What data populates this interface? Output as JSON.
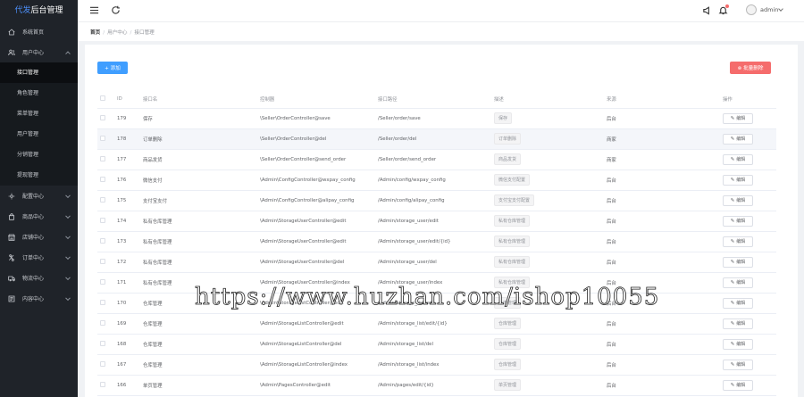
{
  "app": {
    "logo_prefix": "代发",
    "logo_suffix": "后台管理"
  },
  "sidebar": {
    "items": [
      {
        "label": "系统首页",
        "icon": "home-icon"
      },
      {
        "label": "用户中心",
        "icon": "users-icon",
        "open": true
      },
      {
        "label": "配置中心",
        "icon": "config-icon"
      },
      {
        "label": "商品中心",
        "icon": "shop-icon"
      },
      {
        "label": "店铺中心",
        "icon": "store-icon"
      },
      {
        "label": "订单中心",
        "icon": "order-icon"
      },
      {
        "label": "物流中心",
        "icon": "logistics-icon"
      },
      {
        "label": "内容中心",
        "icon": "content-icon"
      }
    ],
    "submenu": [
      "接口管理",
      "角色管理",
      "菜单管理",
      "用户管理",
      "分销管理",
      "提现管理"
    ],
    "active_sub": "接口管理"
  },
  "topbar": {
    "username": "admin"
  },
  "breadcrumb": {
    "home": "首页",
    "parent": "用户中心",
    "current": "接口管理"
  },
  "toolbar": {
    "add_label": "+ 添加",
    "batch_delete_label": "⊗ 批量删除"
  },
  "table": {
    "headers": {
      "id": "ID",
      "name": "接口名",
      "controller": "控制器",
      "path": "接口路径",
      "desc": "描述",
      "source": "来源",
      "ops": "操作"
    },
    "edit_label": "编辑",
    "rows": [
      {
        "id": "179",
        "name": "保存",
        "controller": "\\Seller\\OrderController@save",
        "path": "/Seller/order/save",
        "desc": "保存",
        "source": "后台"
      },
      {
        "id": "178",
        "name": "订单删除",
        "controller": "\\Seller\\OrderController@del",
        "path": "/Seller/order/del",
        "desc": "订单删除",
        "source": "商家"
      },
      {
        "id": "177",
        "name": "商品发货",
        "controller": "\\Seller\\OrderController@send_order",
        "path": "/Seller/order/send_order",
        "desc": "商品发货",
        "source": "商家"
      },
      {
        "id": "176",
        "name": "微信支付",
        "controller": "\\Admin\\ConfigController@wxpay_config",
        "path": "/Admin/config/wxpay_config",
        "desc": "微信支付配置",
        "source": "后台"
      },
      {
        "id": "175",
        "name": "支付宝支付",
        "controller": "\\Admin\\ConfigController@alipay_config",
        "path": "/Admin/config/alipay_config",
        "desc": "支付宝支付配置",
        "source": "后台"
      },
      {
        "id": "174",
        "name": "私有仓库管理",
        "controller": "\\Admin\\StorageUserController@edit",
        "path": "/Admin/storage_user/edit",
        "desc": "私有仓库管理",
        "source": "后台"
      },
      {
        "id": "173",
        "name": "私有仓库管理",
        "controller": "\\Admin\\StorageUserController@edit",
        "path": "/Admin/storage_user/edit/{id}",
        "desc": "私有仓库管理",
        "source": "后台"
      },
      {
        "id": "172",
        "name": "私有仓库管理",
        "controller": "\\Admin\\StorageUserController@del",
        "path": "/Admin/storage_user/del",
        "desc": "私有仓库管理",
        "source": "后台"
      },
      {
        "id": "171",
        "name": "私有仓库管理",
        "controller": "\\Admin\\StorageUserController@index",
        "path": "/Admin/storage_user/index",
        "desc": "私有仓库管理",
        "source": "后台"
      },
      {
        "id": "170",
        "name": "仓库管理",
        "controller": "\\Admin\\StorageListController@edit",
        "path": "/Admin/storage_list/edit",
        "desc": "仓库管理",
        "source": "后台"
      },
      {
        "id": "169",
        "name": "仓库管理",
        "controller": "\\Admin\\StorageListController@edit",
        "path": "/Admin/storage_list/edit/{id}",
        "desc": "仓库管理",
        "source": "后台"
      },
      {
        "id": "168",
        "name": "仓库管理",
        "controller": "\\Admin\\StorageListController@del",
        "path": "/Admin/storage_list/del",
        "desc": "仓库管理",
        "source": "后台"
      },
      {
        "id": "167",
        "name": "仓库管理",
        "controller": "\\Admin\\StorageListController@index",
        "path": "/Admin/storage_list/index",
        "desc": "仓库管理",
        "source": "后台"
      },
      {
        "id": "166",
        "name": "单页管理",
        "controller": "\\Admin\\PagesController@edit",
        "path": "/Admin/pages/edit/{id}",
        "desc": "单页管理",
        "source": "后台"
      }
    ]
  },
  "watermark": "https://www.huzhan.com/ishop10055",
  "colors": {
    "sidebar_bg": "#1f2329",
    "primary": "#409eff",
    "danger": "#f56c6c"
  }
}
